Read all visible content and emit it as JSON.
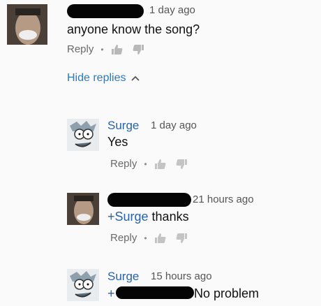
{
  "comments": [
    {
      "time": "1 day ago",
      "text": "anyone know the song?",
      "reply_label": "Reply"
    }
  ],
  "hide_replies": "Hide replies",
  "replies": [
    {
      "author": "Surge",
      "time": "1 day ago",
      "text": "Yes",
      "reply_label": "Reply"
    },
    {
      "time": "21 hours ago",
      "mention": "+Surge",
      "text": " thanks",
      "reply_label": "Reply"
    },
    {
      "author": "Surge",
      "time": "15 hours ago",
      "mention": "+",
      "text": "No problem"
    }
  ],
  "colors": {
    "link": "#2b63a8",
    "hide_replies": "#2b7ac4",
    "text": "#111111",
    "meta": "#555555"
  },
  "icons": [
    "avatar-photo",
    "thumbs-up-icon",
    "thumbs-down-icon",
    "chevron-up-icon",
    "avatar-cartoon"
  ]
}
